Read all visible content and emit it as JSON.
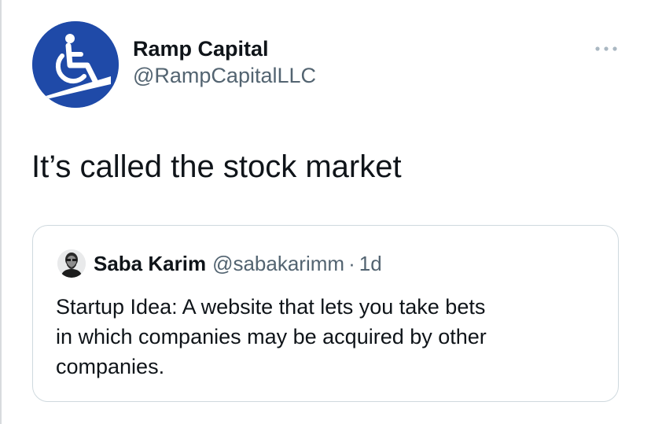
{
  "tweet": {
    "author": {
      "display_name": "Ramp Capital",
      "handle": "@RampCapitalLLC",
      "avatar_icon": "wheelchair-ramp-icon",
      "avatar_color": "#1f4aa8"
    },
    "more_icon": "more-dots-icon",
    "text": "It’s called the stock market",
    "quote": {
      "author": {
        "display_name": "Saba Karim",
        "handle": "@sabakarimm",
        "separator": "·",
        "time": "1d",
        "avatar_icon": "person-avatar-icon"
      },
      "text_lines": [
        "Startup Idea: A website that lets you take bets",
        "in which companies may be acquired by other",
        "companies."
      ]
    }
  },
  "colors": {
    "primary_text": "#0f1419",
    "secondary_text": "#536471",
    "border": "#cfd9de"
  }
}
